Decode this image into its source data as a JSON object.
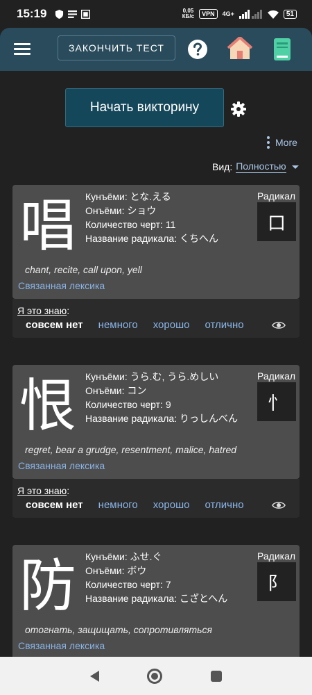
{
  "status_bar": {
    "time": "15:19",
    "speed_value": "0,05",
    "speed_unit": "КБ/с",
    "vpn": "VPN",
    "network": "4G+",
    "battery": "51"
  },
  "header": {
    "finish_label": "ЗАКОНЧИТЬ ТЕСТ",
    "icons": [
      "menu-icon",
      "help-icon",
      "home-icon",
      "book-icon"
    ]
  },
  "controls": {
    "start_label": "Начать викторину",
    "more_label": "More",
    "view_label": "Вид:",
    "view_value": "Полностью"
  },
  "labels": {
    "radical": "Радикал",
    "related": "Связанная лексика",
    "know": "Я это знаю",
    "know_colon": ":",
    "kun": "Кунъёми:",
    "on": "Онъёми:",
    "strokes": "Количество черт:",
    "radical_name": "Название радикала:",
    "options": [
      "совсем нет",
      "немного",
      "хорошо",
      "отлично"
    ]
  },
  "cards": [
    {
      "kanji": "唱",
      "kun": "とな.える",
      "on": "ショウ",
      "strokes": "11",
      "radical_name": "くちへん",
      "radical": "口",
      "meaning": "chant, recite, call upon, yell",
      "selected": 0
    },
    {
      "kanji": "恨",
      "kun": "うら.む, うら.めしい",
      "on": "コン",
      "strokes": "9",
      "radical_name": "りっしんべん",
      "radical": "⺖",
      "meaning": "regret, bear a grudge, resentment, malice, hatred",
      "selected": 0
    },
    {
      "kanji": "防",
      "kun": "ふせ.ぐ",
      "on": "ボウ",
      "strokes": "7",
      "radical_name": "こざとへん",
      "radical": "阝",
      "meaning": "отогнать, защищать, сопротивляться"
    }
  ],
  "colors": {
    "background": "#212121",
    "appbar": "#294b5c",
    "card": "#4d4d4d",
    "link": "#8ab4e6",
    "start_button": "#15475a"
  }
}
